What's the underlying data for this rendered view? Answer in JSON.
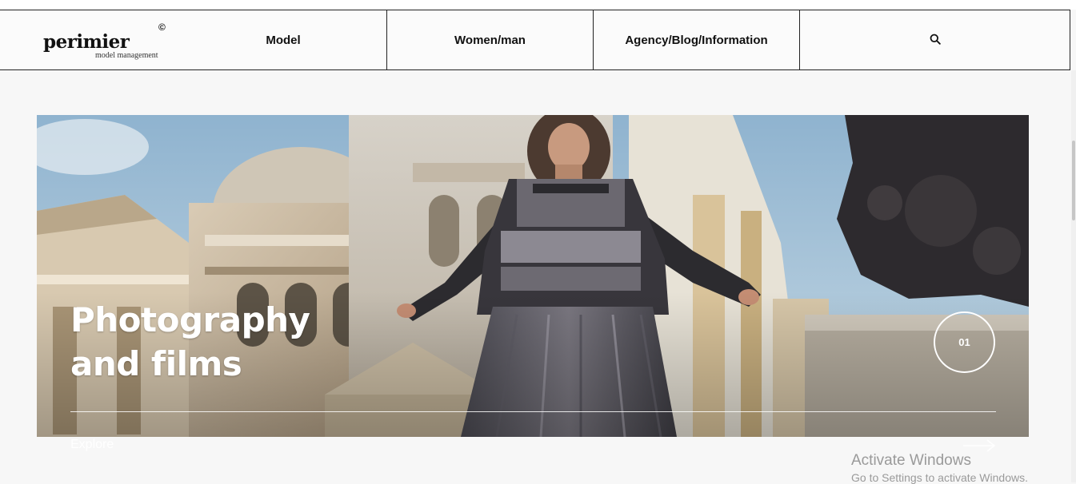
{
  "brand": {
    "name": "perimier",
    "tagline": "model management",
    "mark": "©"
  },
  "nav": {
    "items": [
      {
        "label": "Model"
      },
      {
        "label": "Women/man"
      },
      {
        "label": "Agency/Blog/Information"
      }
    ],
    "search_icon": "search-icon"
  },
  "hero": {
    "title_line1": "Photography",
    "title_line2": "and films",
    "slide_number": "01",
    "explore_label": "Explore",
    "arrow_icon": "arrow-right-icon"
  },
  "os_watermark": {
    "title": "Activate Windows",
    "subtitle": "Go to Settings to activate Windows."
  },
  "colors": {
    "page_background": "#f7f7f7",
    "border": "#222222",
    "hero_text": "#ffffff",
    "watermark_text": "#9a9a9a"
  }
}
